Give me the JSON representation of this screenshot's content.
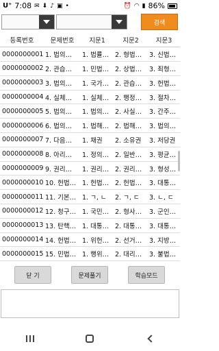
{
  "status_bar": {
    "carrier": "U⁺",
    "time": "7:08",
    "notification_icons": [
      "message-icon",
      "download-icon",
      "music-icon",
      "image-icon",
      "dot-icon"
    ],
    "system_icons": [
      "alarm-icon",
      "wifi-icon",
      "signal-icon"
    ],
    "battery": "86%"
  },
  "toolbar": {
    "dropdown1_value": "",
    "dropdown2_value": "",
    "search_label": "검색",
    "accent_color": "#f08c1e"
  },
  "table": {
    "headers": [
      "등록번호",
      "문제번호",
      "지문1",
      "지문2",
      "지문3"
    ],
    "rows": [
      [
        "0000000001",
        "1. 법의…",
        "1. 법률…",
        "2. 형법…",
        "3. 신법…"
      ],
      [
        "0000000002",
        "2. 관습…",
        "1. 민법…",
        "2. 상법…",
        "3. 죄형…"
      ],
      [
        "0000000003",
        "3. 법의…",
        "1. 국가…",
        "2. 관습…",
        "3. 헌법…"
      ],
      [
        "0000000004",
        "4. 실체…",
        "1. 실체…",
        "2. 행정…",
        "3. 절차…"
      ],
      [
        "0000000005",
        "5. 법의…",
        "1. 법의…",
        "2. 사실…",
        "3. 간주…"
      ],
      [
        "0000000006",
        "6. 법의…",
        "1. 법해…",
        "2. 법해…",
        "3. 법의…"
      ],
      [
        "0000000007",
        "7. 다음…",
        "1. 채권",
        "2. 소유권",
        "3. 저당권"
      ],
      [
        "0000000008",
        "8. 아리…",
        "1. 정의…",
        "2. 일반…",
        "3. 평균…"
      ],
      [
        "0000000009",
        "9. 권리…",
        "1. 권리…",
        "2. 권리…",
        "3. 형성…"
      ],
      [
        "0000000010",
        "10. 헌법…",
        "1. 헌법…",
        "2. 헌법…",
        "3. 대통…"
      ],
      [
        "0000000011",
        "11. 기본…",
        "1. ㄱ, ㄴ",
        "2. ㄱ, ㄷ",
        "3. ㄴ, ㄷ"
      ],
      [
        "0000000012",
        "12. 청구…",
        "1. 국민…",
        "2. 형사…",
        "3. 군인…"
      ],
      [
        "0000000013",
        "13. 탄핵…",
        "1. 대통…",
        "2. 대통…",
        "3. 대통…"
      ],
      [
        "0000000014",
        "14. 헌법…",
        "1. 위헌…",
        "2. 선거…",
        "3. 지방…"
      ],
      [
        "0000000015",
        "15. 민법…",
        "1. 행위…",
        "2. 대리…",
        "3. 불법…"
      ]
    ]
  },
  "buttons": {
    "close_label": "닫 기",
    "solve_label": "문제풀기",
    "study_label": "학습모드"
  },
  "answer_box": {
    "value": ""
  },
  "nav_bar": {
    "icons": [
      "recent-apps-icon",
      "home-icon",
      "back-icon"
    ]
  }
}
